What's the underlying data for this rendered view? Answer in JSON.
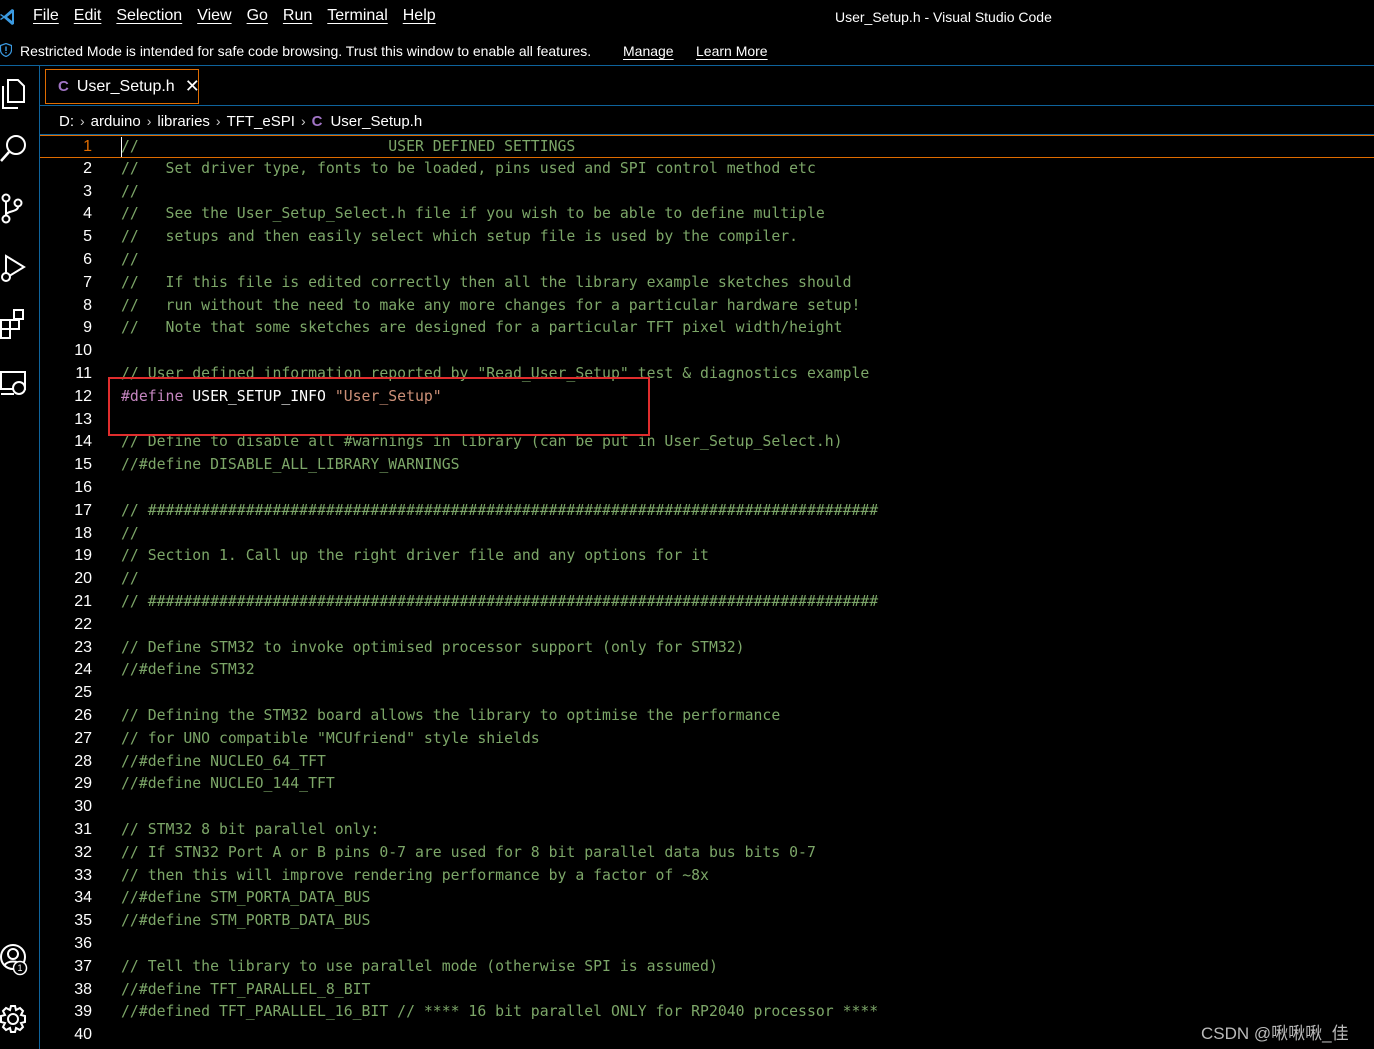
{
  "menu": [
    "File",
    "Edit",
    "Selection",
    "View",
    "Go",
    "Run",
    "Terminal",
    "Help"
  ],
  "window_title": "User_Setup.h - Visual Studio Code",
  "banner": {
    "message": "Restricted Mode is intended for safe code browsing. Trust this window to enable all features.",
    "manage": "Manage",
    "learn_more": "Learn More"
  },
  "tab": {
    "icon": "C",
    "name": "User_Setup.h",
    "close": "✕"
  },
  "breadcrumb": [
    "D:",
    "arduino",
    "libraries",
    "TFT_eSPI",
    "User_Setup.h"
  ],
  "breadcrumb_icon": "C",
  "activity_icons": [
    "explorer-icon",
    "search-icon",
    "source-control-icon",
    "run-debug-icon",
    "extensions-icon",
    "remote-explorer-icon",
    "accounts-icon",
    "settings-gear-icon"
  ],
  "accounts_badge": "1",
  "editor": {
    "active_line": 1,
    "lines": [
      {
        "n": "1",
        "t": "//                            USER DEFINED SETTINGS"
      },
      {
        "n": "2",
        "t": "//   Set driver type, fonts to be loaded, pins used and SPI control method etc"
      },
      {
        "n": "3",
        "t": "//"
      },
      {
        "n": "4",
        "t": "//   See the User_Setup_Select.h file if you wish to be able to define multiple"
      },
      {
        "n": "5",
        "t": "//   setups and then easily select which setup file is used by the compiler."
      },
      {
        "n": "6",
        "t": "//"
      },
      {
        "n": "7",
        "t": "//   If this file is edited correctly then all the library example sketches should"
      },
      {
        "n": "8",
        "t": "//   run without the need to make any more changes for a particular hardware setup!"
      },
      {
        "n": "9",
        "t": "//   Note that some sketches are designed for a particular TFT pixel width/height"
      },
      {
        "n": "10",
        "t": ""
      },
      {
        "n": "11",
        "t": "// User defined information reported by \"Read_User_Setup\" test & diagnostics example"
      },
      {
        "n": "12",
        "define": "#define",
        "name": " USER_SETUP_INFO ",
        "str": "\"User_Setup\""
      },
      {
        "n": "13",
        "t": ""
      },
      {
        "n": "14",
        "t": "// Define to disable all #warnings in library (can be put in User_Setup_Select.h)"
      },
      {
        "n": "15",
        "t": "//#define DISABLE_ALL_LIBRARY_WARNINGS"
      },
      {
        "n": "16",
        "t": ""
      },
      {
        "n": "17",
        "t": "// ##################################################################################"
      },
      {
        "n": "18",
        "t": "//"
      },
      {
        "n": "19",
        "t": "// Section 1. Call up the right driver file and any options for it"
      },
      {
        "n": "20",
        "t": "//"
      },
      {
        "n": "21",
        "t": "// ##################################################################################"
      },
      {
        "n": "22",
        "t": ""
      },
      {
        "n": "23",
        "t": "// Define STM32 to invoke optimised processor support (only for STM32)"
      },
      {
        "n": "24",
        "t": "//#define STM32"
      },
      {
        "n": "25",
        "t": ""
      },
      {
        "n": "26",
        "t": "// Defining the STM32 board allows the library to optimise the performance"
      },
      {
        "n": "27",
        "t": "// for UNO compatible \"MCUfriend\" style shields"
      },
      {
        "n": "28",
        "t": "//#define NUCLEO_64_TFT"
      },
      {
        "n": "29",
        "t": "//#define NUCLEO_144_TFT"
      },
      {
        "n": "30",
        "t": ""
      },
      {
        "n": "31",
        "t": "// STM32 8 bit parallel only:"
      },
      {
        "n": "32",
        "t": "// If STN32 Port A or B pins 0-7 are used for 8 bit parallel data bus bits 0-7"
      },
      {
        "n": "33",
        "t": "// then this will improve rendering performance by a factor of ~8x"
      },
      {
        "n": "34",
        "t": "//#define STM_PORTA_DATA_BUS"
      },
      {
        "n": "35",
        "t": "//#define STM_PORTB_DATA_BUS"
      },
      {
        "n": "36",
        "t": ""
      },
      {
        "n": "37",
        "t": "// Tell the library to use parallel mode (otherwise SPI is assumed)"
      },
      {
        "n": "38",
        "t": "//#define TFT_PARALLEL_8_BIT"
      },
      {
        "n": "39",
        "t": "//#defined TFT_PARALLEL_16_BIT // **** 16 bit parallel ONLY for RP2040 processor ****"
      },
      {
        "n": "40",
        "t": ""
      }
    ]
  },
  "watermark": "CSDN @啾啾啾_佳",
  "colors": {
    "comment": "#7ca668",
    "keyword": "#c586c0",
    "string": "#ce9178",
    "accent_border": "#e06c00",
    "highlight_box": "#e02d2d",
    "separator": "#0e639c"
  }
}
